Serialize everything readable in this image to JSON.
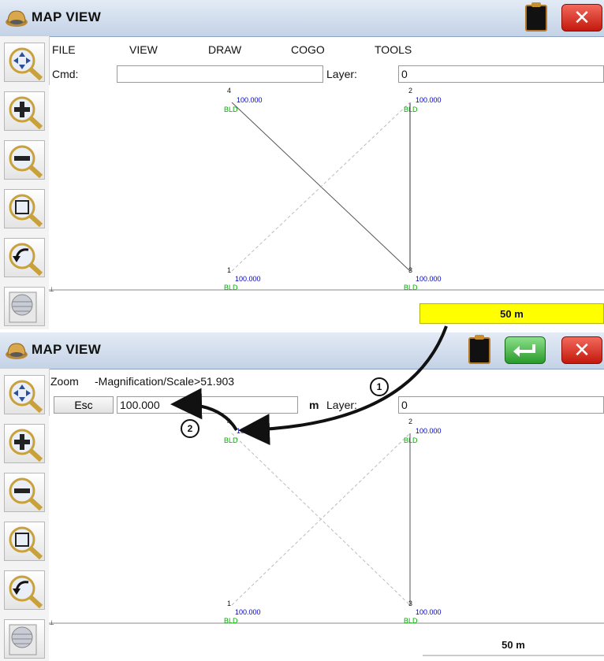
{
  "app": {
    "title": "MAP VIEW"
  },
  "panel1": {
    "menu": [
      "FILE",
      "VIEW",
      "DRAW",
      "COGO",
      "TOOLS"
    ],
    "cmd_label": "Cmd:",
    "cmd_value": "",
    "layer_label": "Layer:",
    "layer_value": "0",
    "scale_label": "50 m"
  },
  "panel2": {
    "prompt_label": "Zoom",
    "prompt_text": "-Magnification/Scale>51.903",
    "esc_label": "Esc",
    "input_value": "100.000",
    "unit_label": "m",
    "layer_label": "Layer:",
    "layer_value": "0",
    "scale_label": "50 m"
  },
  "points": [
    {
      "id": "4",
      "elev": "100.000",
      "code": "BLD"
    },
    {
      "id": "2",
      "elev": "100.000",
      "code": "BLD"
    },
    {
      "id": "1",
      "elev": "100.000",
      "code": "BLD"
    },
    {
      "id": "3",
      "elev": "100.000",
      "code": "BLD"
    }
  ],
  "callouts": [
    "1",
    "2"
  ],
  "toolbar_icons": [
    "pan-zoom-icon",
    "zoom-in-icon",
    "zoom-out-icon",
    "zoom-window-icon",
    "zoom-previous-icon",
    "layers-icon"
  ],
  "colors": {
    "accent_yellow": "#ffff00",
    "point_label": "#0000cc",
    "code_label": "#00aa00",
    "close_red": "#d9281a",
    "enter_green": "#3aaa3a"
  }
}
